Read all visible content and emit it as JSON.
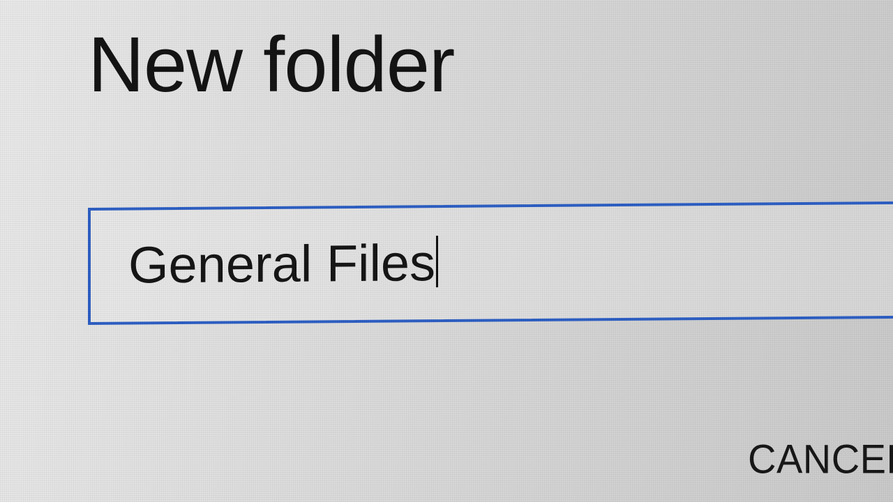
{
  "dialog": {
    "title": "New folder",
    "folder_name_input": {
      "value": "General Files"
    },
    "cancel_label": "CANCEL"
  },
  "colors": {
    "accent": "#2d5fc4",
    "background": "#dedede",
    "text": "#141414"
  }
}
